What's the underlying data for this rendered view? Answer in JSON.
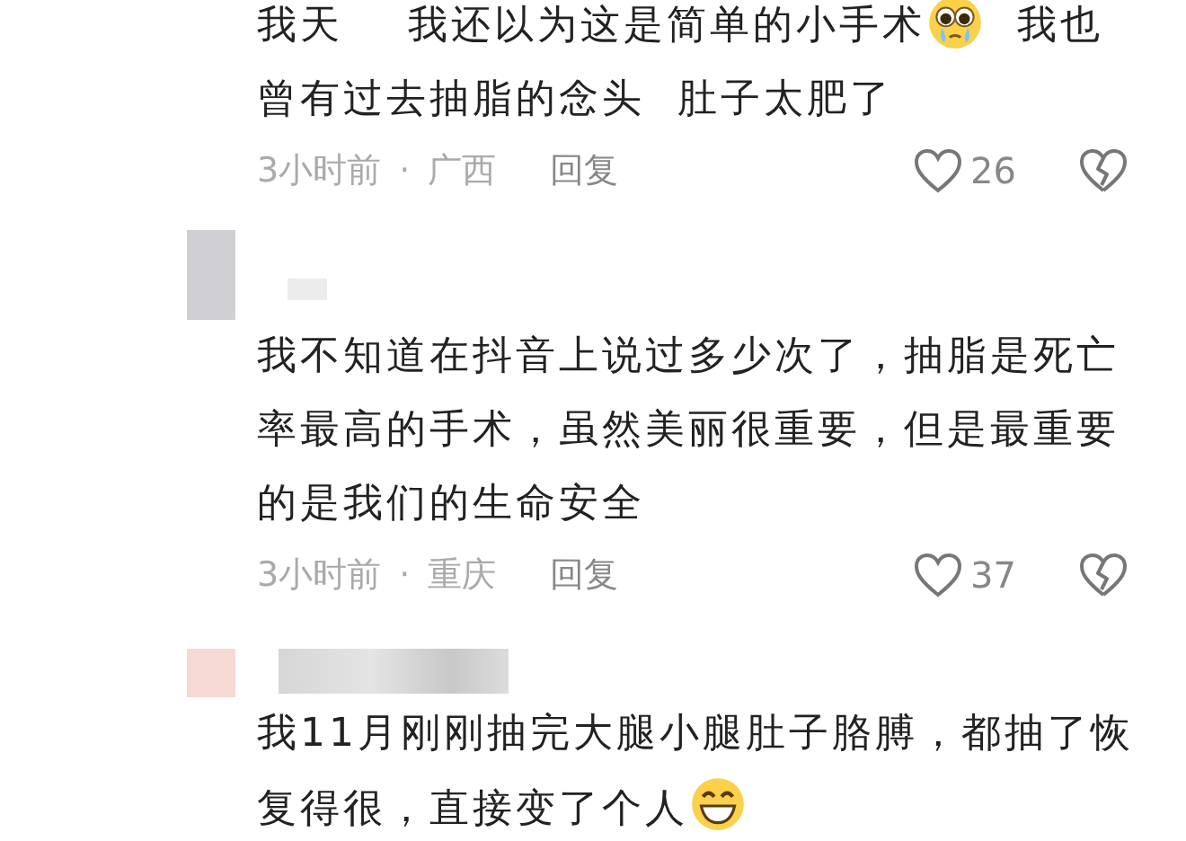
{
  "comments": [
    {
      "lines": [
        [
          {
            "kind": "text",
            "text": "我天    我还以为这是简单的小手术"
          },
          {
            "kind": "teary-emoji"
          },
          {
            "kind": "text",
            "text": "  我也"
          }
        ],
        [
          {
            "kind": "text",
            "text": "曾有过去抽脂的念头  肚子太肥了"
          }
        ]
      ],
      "time": "3小时前",
      "separator": "·",
      "location": "广西",
      "reply": "回复",
      "likes": "26"
    },
    {
      "avatar": {
        "color": "#cfcfd4"
      },
      "lines": [
        [
          {
            "kind": "text",
            "text": "我不知道在抖音上说过多少次了，抽脂是死亡率最高的手术，虽然美丽很重要，但是最重要的是我们的生命安全"
          }
        ]
      ],
      "time": "3小时前",
      "separator": "·",
      "location": "重庆",
      "reply": "回复",
      "likes": "37"
    },
    {
      "avatar": {
        "color": "#f6d9d2"
      },
      "lines": [
        [
          {
            "kind": "text",
            "text": "我11月刚刚抽完大腿小腿肚子胳膊，都抽了恢"
          }
        ],
        [
          {
            "kind": "text",
            "text": "复得很，直接变了个人"
          },
          {
            "kind": "grin-emoji"
          }
        ]
      ]
    }
  ]
}
